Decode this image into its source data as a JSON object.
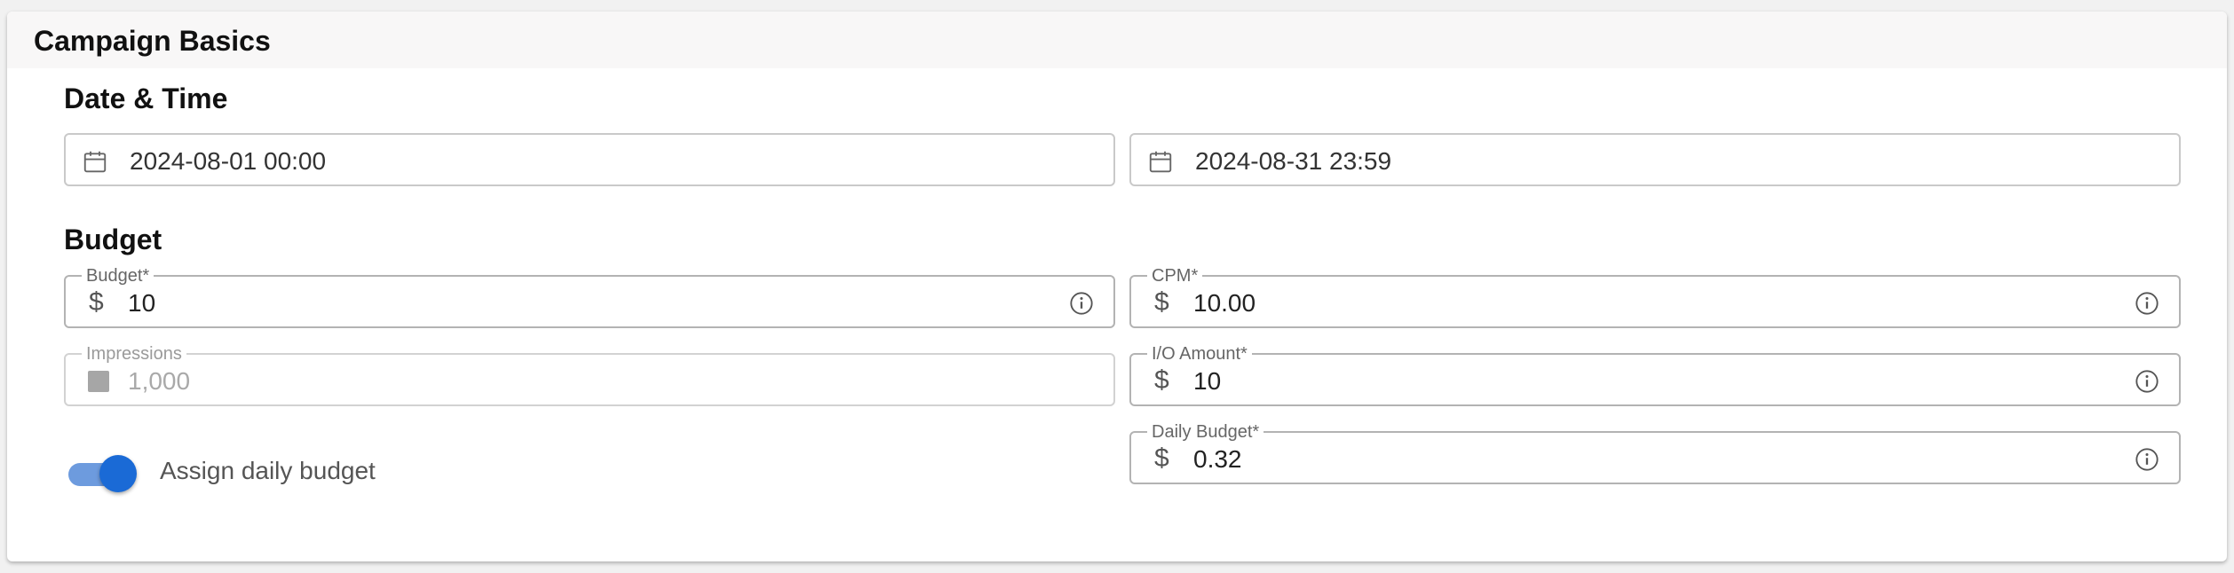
{
  "card": {
    "title": "Campaign Basics"
  },
  "date_time": {
    "heading": "Date & Time",
    "start": {
      "value": "2024-08-01 00:00",
      "icon": "calendar-icon"
    },
    "end": {
      "value": "2024-08-31 23:59",
      "icon": "calendar-icon"
    }
  },
  "budget": {
    "heading": "Budget",
    "budget_field": {
      "label": "Budget*",
      "prefix": "$",
      "value": "10"
    },
    "cpm_field": {
      "label": "CPM*",
      "prefix": "$",
      "value": "10.00"
    },
    "impressions_field": {
      "label": "Impressions",
      "value": "1,000"
    },
    "io_amount_field": {
      "label": "I/O Amount*",
      "prefix": "$",
      "value": "10"
    },
    "daily_budget_field": {
      "label": "Daily Budget*",
      "prefix": "$",
      "value": "0.32"
    },
    "assign_daily": {
      "label": "Assign daily budget",
      "checked": true
    }
  },
  "colors": {
    "accent": "#1a6ad6",
    "accent_track": "#6d9bde",
    "header_bg": "#f8f7f7",
    "border": "#b3b3b3"
  }
}
